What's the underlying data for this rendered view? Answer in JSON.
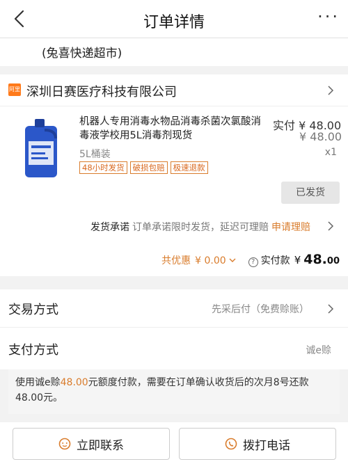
{
  "header": {
    "title": "订单详情",
    "more_label": "···"
  },
  "address": {
    "text": "(兔喜快递超市)"
  },
  "shop": {
    "logo_text": "阿里",
    "name": "深圳日赛医疗科技有限公司"
  },
  "product": {
    "title": "机器人专用消毒水物品消毒杀菌次氯酸消毒液学校用5L消毒剂现货",
    "actual_label": "实付 ¥ 48.00",
    "orig_price": "¥ 48.00",
    "spec": "5L桶装",
    "qty": "x1",
    "tags": [
      "48小时发货",
      "破损包赔",
      "极速退款"
    ]
  },
  "status_button": "已发货",
  "promise": {
    "label": "发货承诺",
    "text": "订单承诺限时发货，延迟可理赔",
    "link": "申请理赔"
  },
  "totals": {
    "discount_label": "共优惠",
    "discount_value": "¥ 0.00",
    "paid_label": "实付款",
    "currency": "¥",
    "amount_int": "48.",
    "amount_dec": "00"
  },
  "trade": {
    "label": "交易方式",
    "value": "先采后付（免费赊账）"
  },
  "payment": {
    "label": "支付方式",
    "value": "诚e赊"
  },
  "note": {
    "prefix": "使用诚e赊",
    "amount": "48.00",
    "suffix": "元额度付款，需要在订单确认收货后的次月8号还款48.00元。"
  },
  "buttons": {
    "contact": "立即联系",
    "call": "拨打电话"
  },
  "colors": {
    "accent": "#d97c2c",
    "shop_logo": "#ff7a1a",
    "bottle": "#2b57c9"
  },
  "icons": [
    "back-icon",
    "more-icon",
    "chevron-right-icon",
    "chat-icon",
    "phone-icon",
    "help-icon"
  ]
}
